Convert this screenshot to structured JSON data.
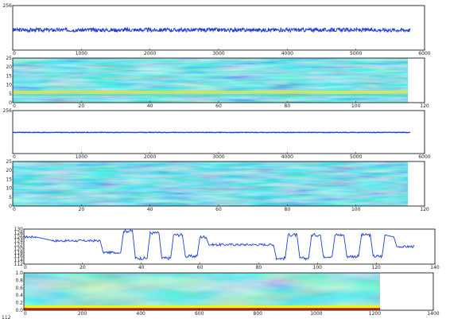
{
  "chart_data": [
    {
      "id": "p1",
      "type": "line",
      "xlim": [
        0,
        6000
      ],
      "ylim": [
        0,
        256
      ],
      "x_ticks": [
        "0",
        "1000",
        "2000",
        "3000",
        "4000",
        "5000",
        "6000"
      ],
      "y_ticks": [
        "256"
      ],
      "x_range": [
        0,
        5790
      ],
      "series": [
        {
          "baseline": 116,
          "noise": 11,
          "color": "#1f3fd4"
        }
      ]
    },
    {
      "id": "p2",
      "type": "heatmap",
      "xlim": [
        0,
        120
      ],
      "ylim": [
        0,
        25
      ],
      "data_x_extent": [
        0,
        113
      ],
      "x_ticks": [
        "0",
        "20",
        "40",
        "60",
        "80",
        "100",
        "120"
      ],
      "y_ticks": [
        "0",
        "5",
        "10",
        "15",
        "20",
        "25"
      ],
      "band_y": 4,
      "colormap": "jet"
    },
    {
      "id": "p3",
      "type": "line",
      "xlim": [
        0,
        6000
      ],
      "ylim": [
        0,
        256
      ],
      "x_ticks": [
        "0",
        "1000",
        "2000",
        "3000",
        "4000",
        "5000",
        "6000"
      ],
      "y_ticks": [
        "256"
      ],
      "x_range": [
        0,
        5790
      ],
      "series": [
        {
          "baseline": 126,
          "noise": 1.5,
          "color": "#1f3fd4"
        }
      ]
    },
    {
      "id": "p4",
      "type": "heatmap",
      "xlim": [
        0,
        120
      ],
      "ylim": [
        0,
        25
      ],
      "data_x_extent": [
        0,
        113
      ],
      "x_ticks": [
        "0",
        "20",
        "40",
        "60",
        "80",
        "100",
        "120"
      ],
      "y_ticks": [
        "0",
        "5",
        "10",
        "15",
        "20",
        "25"
      ],
      "colormap": "jet"
    },
    {
      "id": "p5",
      "type": "line",
      "xlim": [
        0,
        140
      ],
      "ylim": [
        112,
        130
      ],
      "x_ticks": [
        "0",
        "20",
        "40",
        "60",
        "80",
        "100",
        "120",
        "140"
      ],
      "y_ticks": [
        "112",
        "114",
        "116",
        "118",
        "120",
        "122",
        "124",
        "126",
        "128",
        "130"
      ],
      "series": [
        {
          "color": "#1f3fd4",
          "segments": [
            [
              0,
              126,
              "n"
            ],
            [
              4,
              126,
              "n"
            ],
            [
              10,
              124,
              "n"
            ],
            [
              26,
              124,
              "n"
            ],
            [
              27,
              118,
              "n"
            ],
            [
              33,
              118,
              "n"
            ],
            [
              34,
              129,
              "h"
            ],
            [
              37,
              129,
              "h"
            ],
            [
              38,
              115,
              "l"
            ],
            [
              42,
              115,
              "l"
            ],
            [
              43,
              128,
              "h"
            ],
            [
              46,
              128,
              "h"
            ],
            [
              47,
              115,
              "l"
            ],
            [
              50,
              115,
              "l"
            ],
            [
              51,
              127,
              "h"
            ],
            [
              54,
              127,
              "h"
            ],
            [
              55,
              116,
              "l"
            ],
            [
              59,
              116,
              "l"
            ],
            [
              60,
              126,
              "h"
            ],
            [
              62,
              126,
              "h"
            ],
            [
              63,
              122,
              "n"
            ],
            [
              85,
              122,
              "n"
            ],
            [
              86,
              115,
              "l"
            ],
            [
              89,
              115,
              "l"
            ],
            [
              90,
              127,
              "h"
            ],
            [
              93,
              127,
              "h"
            ],
            [
              94,
              115,
              "l"
            ],
            [
              97,
              115,
              "l"
            ],
            [
              98,
              127,
              "h"
            ],
            [
              101,
              127,
              "h"
            ],
            [
              102,
              116,
              "l"
            ],
            [
              105,
              116,
              "l"
            ],
            [
              106,
              127,
              "h"
            ],
            [
              109,
              127,
              "h"
            ],
            [
              110,
              116,
              "l"
            ],
            [
              114,
              116,
              "l"
            ],
            [
              115,
              127,
              "h"
            ],
            [
              118,
              127,
              "h"
            ],
            [
              119,
              116,
              "l"
            ],
            [
              122,
              116,
              "l"
            ],
            [
              123,
              127,
              "h"
            ],
            [
              126,
              126,
              "h"
            ],
            [
              127,
              121,
              "n"
            ],
            [
              133,
              121,
              "n"
            ]
          ]
        }
      ]
    },
    {
      "id": "p6",
      "type": "heatmap",
      "xlim": [
        0,
        1400
      ],
      "ylim": [
        0,
        1.0
      ],
      "data_x_extent": [
        0,
        1225
      ],
      "x_ticks": [
        "0",
        "200",
        "400",
        "600",
        "800",
        "1000",
        "1200",
        "1400"
      ],
      "y_ticks": [
        "0.0",
        "0.2",
        "0.4",
        "0.6",
        "0.8",
        "1.0"
      ],
      "band_y": 0.02,
      "colormap": "jet"
    }
  ],
  "extra_ticks": {
    "bottom_cutoff": [
      "112"
    ]
  }
}
